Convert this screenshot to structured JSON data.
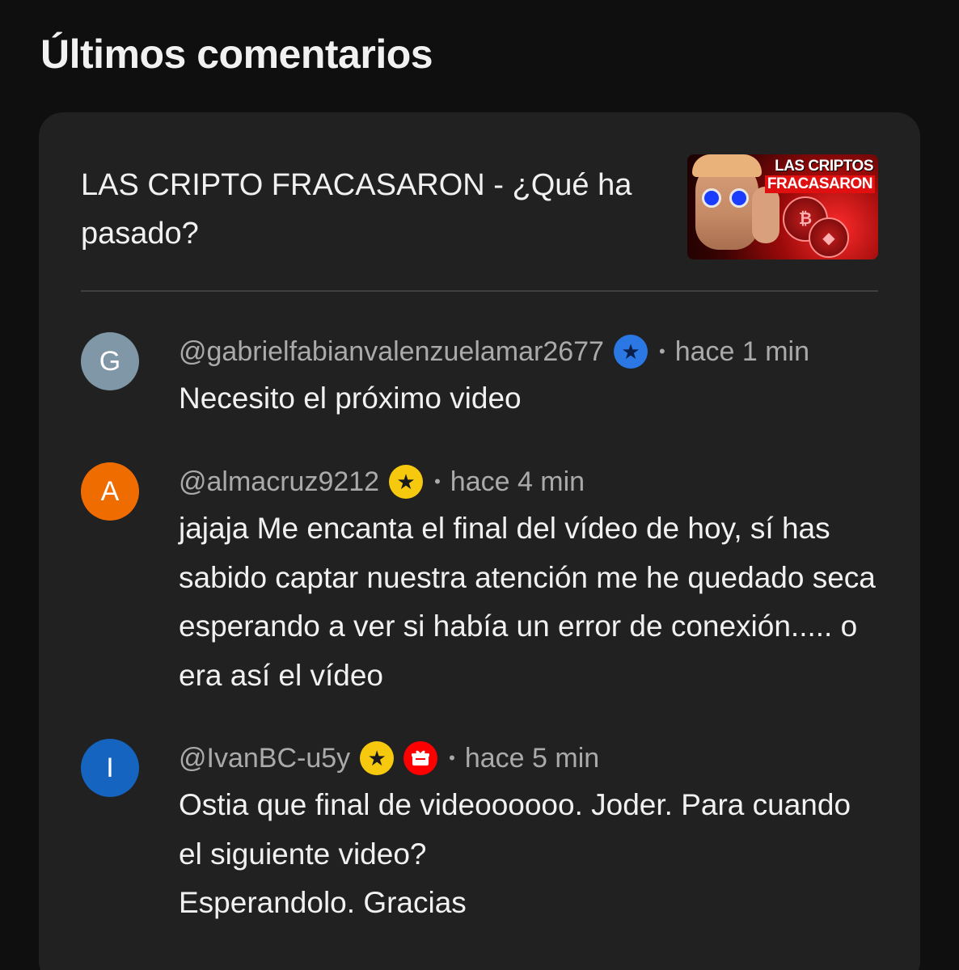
{
  "section": {
    "title": "Últimos comentarios"
  },
  "video": {
    "title": "LAS CRIPTO FRACASARON - ¿Qué ha pasado?",
    "thumbnail": {
      "line1": "LAS CRIPTOS",
      "line2": "FRACASARON",
      "coin1": "₿",
      "coin2": "◆"
    }
  },
  "comments": [
    {
      "initial": "G",
      "avatar_color": "#7f97a6",
      "author": "@gabrielfabianvalenzuelamar2677",
      "badges": [
        "star-badge-icon-blue"
      ],
      "time": "hace 1 min",
      "text": "Necesito el próximo video"
    },
    {
      "initial": "A",
      "avatar_color": "#ef6c00",
      "author": "@almacruz9212",
      "badges": [
        "star-badge-icon-gold"
      ],
      "time": "hace 4 min",
      "text": "jajaja Me encanta el final del vídeo de hoy, sí has sabido captar nuestra atención me he quedado seca esperando a ver si había un error de conexión..... o era así el vídeo"
    },
    {
      "initial": "I",
      "avatar_color": "#1565c0",
      "author": "@IvanBC-u5y",
      "badges": [
        "star-badge-icon-gold",
        "gift-badge-icon-red"
      ],
      "time": "hace 5 min",
      "text": "Ostia que final de videoooooo. Joder. Para cuando el siguiente video?\nEsperandolo. Gracias"
    }
  ],
  "separator": "•"
}
